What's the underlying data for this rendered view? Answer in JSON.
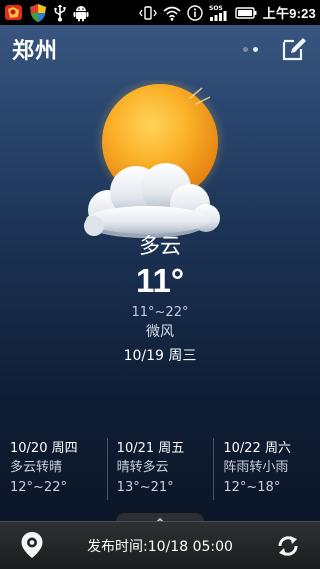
{
  "status_bar": {
    "time": "上午9:23",
    "icons": [
      "app-icon-red",
      "shield-icon",
      "usb-icon",
      "android-debug-icon",
      "signal-icon",
      "vibrate-icon",
      "wifi-icon",
      "info-icon",
      "sos-signal-icon",
      "battery-icon"
    ]
  },
  "header": {
    "city": "郑州",
    "page_count": 2,
    "active_page": 2,
    "edit_icon": "edit-icon"
  },
  "current": {
    "condition": "多云",
    "temperature": "11°",
    "range": "11°~22°",
    "wind": "微风",
    "date": "10/19 周三",
    "illustration": "sun-behind-cloud-icon"
  },
  "forecast": [
    {
      "date": "10/20 周四",
      "condition": "多云转晴",
      "range": "12°~22°"
    },
    {
      "date": "10/21 周五",
      "condition": "晴转多云",
      "range": "13°~21°"
    },
    {
      "date": "10/22 周六",
      "condition": "阵雨转小雨",
      "range": "12°~18°"
    }
  ],
  "bottom_bar": {
    "publish_time": "发布时间:10/18 05:00",
    "location_icon": "location-pin-icon",
    "refresh_icon": "refresh-icon",
    "handle_icon": "chevron-up-icon"
  },
  "colors": {
    "background_top": "#3b5a84",
    "background_bottom": "#0a1322",
    "sun": "#f7a11a"
  }
}
